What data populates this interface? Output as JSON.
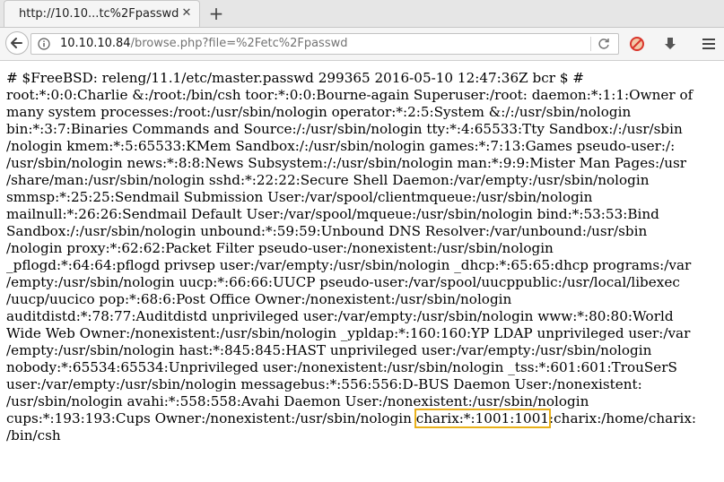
{
  "tab": {
    "title": "http://10.10...tc%2Fpasswd"
  },
  "address": {
    "host": "10.10.10.84",
    "path": "/browse.php?file=%2Fetc%2Fpasswd"
  },
  "icons": {
    "tab_close": "close-icon",
    "new_tab": "plus-icon",
    "back": "back-arrow-icon",
    "info": "info-icon",
    "reload": "reload-icon",
    "blocked_addon": "blocked-circle-icon",
    "download": "download-arrow-icon",
    "menu": "hamburger-menu-icon"
  },
  "highlight_color": "#e9b11a",
  "content": {
    "lines": [
      "# $FreeBSD: releng/11.1/etc/master.passwd 299365 2016-05-10 12:47:36Z bcr $ #",
      "root:*:0:0:Charlie &:/root:/bin/csh toor:*:0:0:Bourne-again Superuser:/root: daemon:*:1:1:Owner of",
      "many system processes:/root:/usr/sbin/nologin operator:*:2:5:System &:/:/usr/sbin/nologin",
      "bin:*:3:7:Binaries Commands and Source:/:/usr/sbin/nologin tty:*:4:65533:Tty Sandbox:/:/usr/sbin",
      "/nologin kmem:*:5:65533:KMem Sandbox:/:/usr/sbin/nologin games:*:7:13:Games pseudo-user:/:",
      "/usr/sbin/nologin news:*:8:8:News Subsystem:/:/usr/sbin/nologin man:*:9:9:Mister Man Pages:/usr",
      "/share/man:/usr/sbin/nologin sshd:*:22:22:Secure Shell Daemon:/var/empty:/usr/sbin/nologin",
      "smmsp:*:25:25:Sendmail Submission User:/var/spool/clientmqueue:/usr/sbin/nologin",
      "mailnull:*:26:26:Sendmail Default User:/var/spool/mqueue:/usr/sbin/nologin bind:*:53:53:Bind",
      "Sandbox:/:/usr/sbin/nologin unbound:*:59:59:Unbound DNS Resolver:/var/unbound:/usr/sbin",
      "/nologin proxy:*:62:62:Packet Filter pseudo-user:/nonexistent:/usr/sbin/nologin",
      "_pflogd:*:64:64:pflogd privsep user:/var/empty:/usr/sbin/nologin _dhcp:*:65:65:dhcp programs:/var",
      "/empty:/usr/sbin/nologin uucp:*:66:66:UUCP pseudo-user:/var/spool/uucppublic:/usr/local/libexec",
      "/uucp/uucico pop:*:68:6:Post Office Owner:/nonexistent:/usr/sbin/nologin",
      "auditdistd:*:78:77:Auditdistd unprivileged user:/var/empty:/usr/sbin/nologin www:*:80:80:World",
      "Wide Web Owner:/nonexistent:/usr/sbin/nologin _ypldap:*:160:160:YP LDAP unprivileged user:/var",
      "/empty:/usr/sbin/nologin hast:*:845:845:HAST unprivileged user:/var/empty:/usr/sbin/nologin",
      "nobody:*:65534:65534:Unprivileged user:/nonexistent:/usr/sbin/nologin _tss:*:601:601:TrouSerS",
      "user:/var/empty:/usr/sbin/nologin messagebus:*:556:556:D-BUS Daemon User:/nonexistent:",
      "/usr/sbin/nologin avahi:*:558:558:Avahi Daemon User:/nonexistent:/usr/sbin/nologin"
    ],
    "last_line_prefix": "cups:*:193:193:Cups Owner:/nonexistent:/usr/sbin/nologin ",
    "highlighted": "charix:*:1001:1001",
    "last_line_suffix": ":charix:/home/charix:",
    "final_line": "/bin/csh"
  }
}
